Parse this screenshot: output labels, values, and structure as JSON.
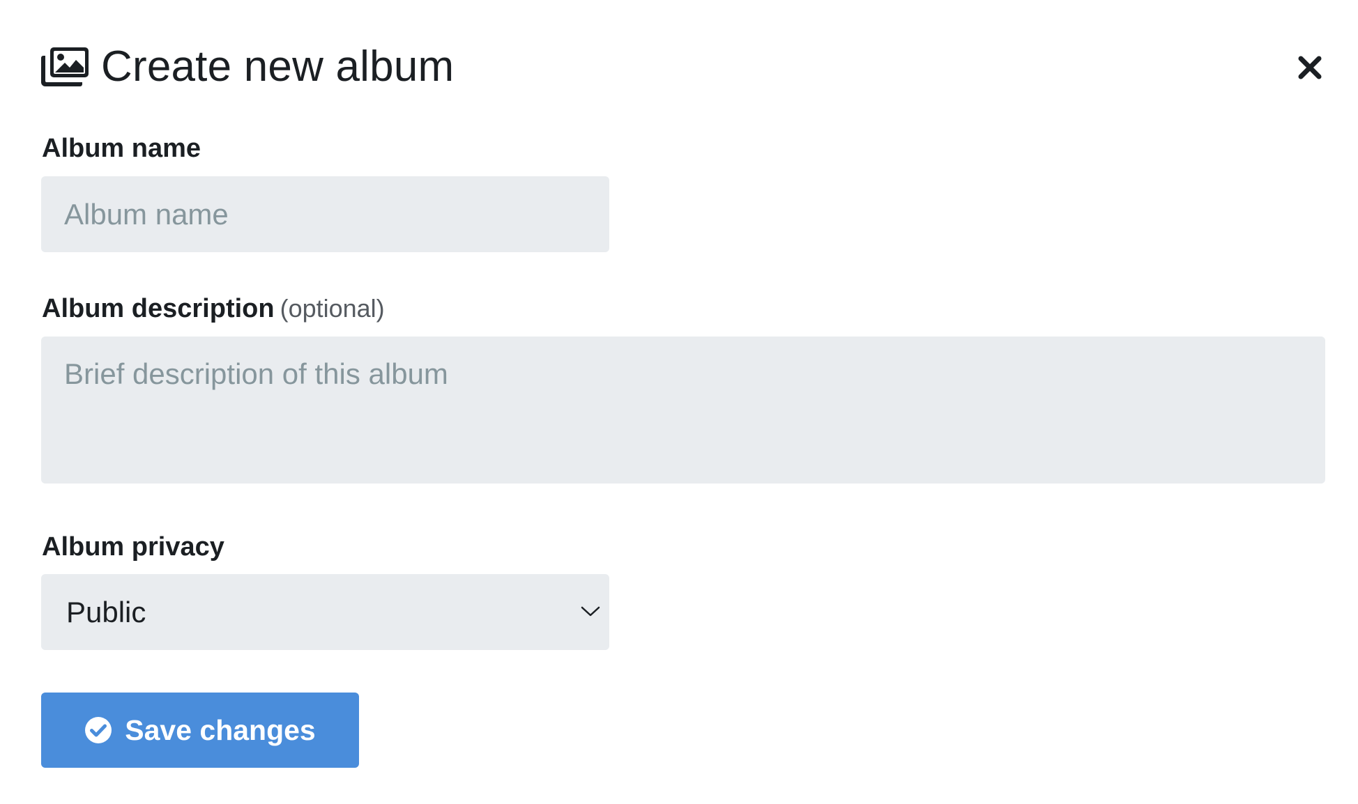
{
  "dialog": {
    "title": "Create new album",
    "title_icon": "images-icon",
    "close_icon": "close-icon"
  },
  "fields": {
    "name": {
      "label": "Album name",
      "value": "",
      "placeholder": "Album name"
    },
    "description": {
      "label": "Album description",
      "optional_note": "(optional)",
      "value": "",
      "placeholder": "Brief description of this album"
    },
    "privacy": {
      "label": "Album privacy",
      "selected": "Public",
      "dropdown_icon": "chevron-down-icon"
    }
  },
  "actions": {
    "save_label": "Save changes",
    "save_icon": "check-circle-icon"
  },
  "colors": {
    "primary": "#4a8ddb",
    "input_background": "#e9ecef",
    "placeholder": "#86969c",
    "text": "#1b1f23"
  }
}
